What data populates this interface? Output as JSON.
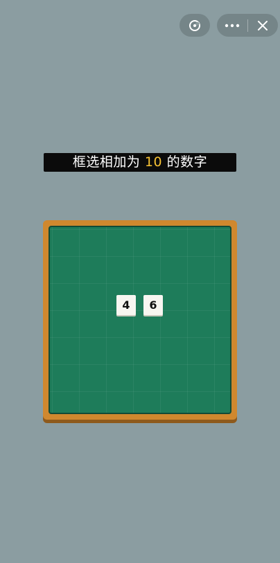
{
  "controls": {
    "game_center_icon": "game-center-icon",
    "more_icon": "more-icon",
    "close_icon": "close-icon"
  },
  "instruction": {
    "prefix": "框选相加为 ",
    "target": "10",
    "suffix": " 的数字"
  },
  "board": {
    "tiles": [
      {
        "value": "4"
      },
      {
        "value": "6"
      }
    ]
  },
  "colors": {
    "background": "#8b9da1",
    "board_green": "#1e7c5a",
    "frame_wood": "#d0882e",
    "highlight_number": "#f6c234"
  }
}
